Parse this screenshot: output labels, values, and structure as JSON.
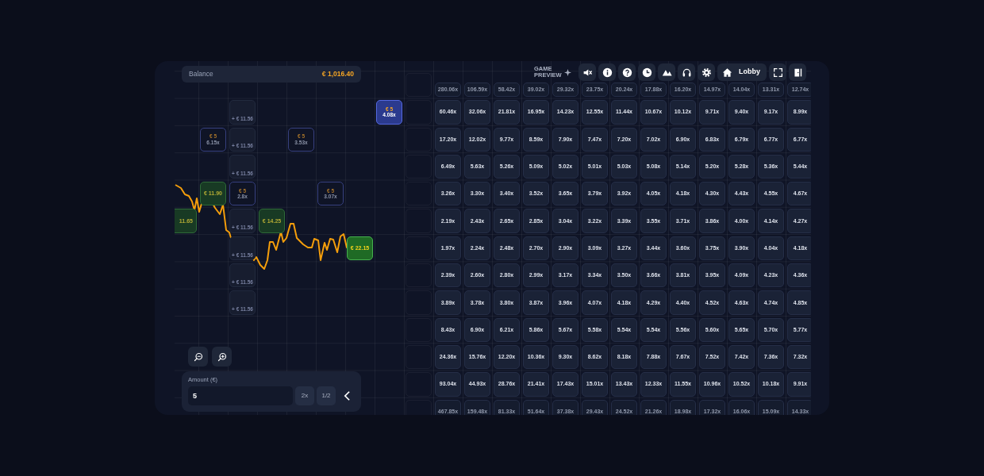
{
  "balance": {
    "label": "Balance",
    "value": "€ 1,016.40"
  },
  "logo": {
    "text": "GAME PREVIEW"
  },
  "toolbar": [
    {
      "kind": "mute"
    },
    {
      "kind": "info"
    },
    {
      "kind": "help"
    },
    {
      "kind": "history"
    },
    {
      "kind": "mountains"
    },
    {
      "kind": "support"
    },
    {
      "kind": "settings"
    },
    {
      "kind": "lobby",
      "label": "Lobby"
    },
    {
      "kind": "fullscreen"
    },
    {
      "kind": "exit"
    }
  ],
  "board": {
    "rows": [
      {
        "faded": true,
        "left": [
          {
            "kind": "blank"
          },
          {
            "kind": "blank"
          },
          {
            "kind": "blank"
          },
          {
            "kind": "blank"
          },
          {
            "kind": "blank"
          },
          {
            "kind": "blank"
          },
          {
            "kind": "blank"
          },
          {
            "kind": "blank"
          },
          {
            "kind": "slot"
          }
        ],
        "multipliers": [
          "280.06x",
          "106.59x",
          "58.42x",
          "39.02x",
          "29.32x",
          "23.75x",
          "20.24x",
          "17.88x",
          "16.20x",
          "14.97x",
          "14.04x",
          "13.31x",
          "12.74x"
        ]
      },
      {
        "faded": false,
        "left": [
          {
            "kind": "blank"
          },
          {
            "kind": "blank"
          },
          {
            "kind": "ghost",
            "payout": "+ € 11.56"
          },
          {
            "kind": "blank"
          },
          {
            "kind": "blank"
          },
          {
            "kind": "blank"
          },
          {
            "kind": "blank"
          },
          {
            "kind": "bet",
            "amount": "€ 5",
            "multiplier": "4.08x",
            "highlighted": true
          },
          {
            "kind": "slot"
          }
        ],
        "multipliers": [
          "60.46x",
          "32.06x",
          "21.81x",
          "16.95x",
          "14.23x",
          "12.55x",
          "11.44x",
          "10.67x",
          "10.12x",
          "9.71x",
          "9.40x",
          "9.17x",
          "8.99x"
        ]
      },
      {
        "faded": false,
        "left": [
          {
            "kind": "blank"
          },
          {
            "kind": "bet",
            "amount": "€ 5",
            "multiplier": "6.15x",
            "highlighted": false
          },
          {
            "kind": "ghost",
            "payout": "+ € 11.56"
          },
          {
            "kind": "blank"
          },
          {
            "kind": "bet",
            "amount": "€ 5",
            "multiplier": "3.53x",
            "highlighted": false
          },
          {
            "kind": "blank"
          },
          {
            "kind": "blank"
          },
          {
            "kind": "blank"
          },
          {
            "kind": "slot"
          }
        ],
        "multipliers": [
          "17.20x",
          "12.02x",
          "9.77x",
          "8.59x",
          "7.90x",
          "7.47x",
          "7.20x",
          "7.02x",
          "6.90x",
          "6.83x",
          "6.79x",
          "6.77x",
          "6.77x"
        ]
      },
      {
        "faded": false,
        "left": [
          {
            "kind": "blank"
          },
          {
            "kind": "blank"
          },
          {
            "kind": "ghost",
            "payout": "+ € 11.56"
          },
          {
            "kind": "blank"
          },
          {
            "kind": "blank"
          },
          {
            "kind": "blank"
          },
          {
            "kind": "blank"
          },
          {
            "kind": "blank"
          },
          {
            "kind": "slot"
          }
        ],
        "multipliers": [
          "6.49x",
          "5.63x",
          "5.26x",
          "5.09x",
          "5.02x",
          "5.01x",
          "5.03x",
          "5.08x",
          "5.14x",
          "5.20x",
          "5.28x",
          "5.36x",
          "5.44x"
        ]
      },
      {
        "faded": false,
        "left": [
          {
            "kind": "blank"
          },
          {
            "kind": "win",
            "amount": "€ 11.90",
            "highlighted": false
          },
          {
            "kind": "bet",
            "amount": "€ 5",
            "multiplier": "2.8x",
            "highlighted": false
          },
          {
            "kind": "blank"
          },
          {
            "kind": "blank"
          },
          {
            "kind": "bet",
            "amount": "€ 5",
            "multiplier": "3.07x",
            "highlighted": false
          },
          {
            "kind": "blank"
          },
          {
            "kind": "blank"
          },
          {
            "kind": "slot"
          }
        ],
        "multipliers": [
          "3.26x",
          "3.30x",
          "3.40x",
          "3.52x",
          "3.65x",
          "3.79x",
          "3.92x",
          "4.05x",
          "4.18x",
          "4.30x",
          "4.43x",
          "4.55x",
          "4.67x"
        ]
      },
      {
        "faded": false,
        "left": [
          {
            "kind": "win",
            "amount": "11.65",
            "highlighted": false
          },
          {
            "kind": "blank"
          },
          {
            "kind": "ghost",
            "payout": "+ € 11.56"
          },
          {
            "kind": "win",
            "amount": "€ 14.25",
            "highlighted": false
          },
          {
            "kind": "blank"
          },
          {
            "kind": "blank"
          },
          {
            "kind": "blank"
          },
          {
            "kind": "blank"
          },
          {
            "kind": "slot"
          }
        ],
        "multipliers": [
          "2.19x",
          "2.43x",
          "2.65x",
          "2.85x",
          "3.04x",
          "3.22x",
          "3.39x",
          "3.55x",
          "3.71x",
          "3.86x",
          "4.00x",
          "4.14x",
          "4.27x"
        ]
      },
      {
        "faded": false,
        "left": [
          {
            "kind": "blank"
          },
          {
            "kind": "blank"
          },
          {
            "kind": "ghost",
            "payout": "+ € 11.56"
          },
          {
            "kind": "blank"
          },
          {
            "kind": "blank"
          },
          {
            "kind": "blank"
          },
          {
            "kind": "win",
            "amount": "€ 22.15",
            "highlighted": true
          },
          {
            "kind": "blank"
          },
          {
            "kind": "slot"
          }
        ],
        "multipliers": [
          "1.97x",
          "2.24x",
          "2.48x",
          "2.70x",
          "2.90x",
          "3.09x",
          "3.27x",
          "3.44x",
          "3.60x",
          "3.75x",
          "3.90x",
          "4.04x",
          "4.18x"
        ]
      },
      {
        "faded": false,
        "left": [
          {
            "kind": "blank"
          },
          {
            "kind": "blank"
          },
          {
            "kind": "ghost",
            "payout": "+ € 11.56"
          },
          {
            "kind": "blank"
          },
          {
            "kind": "blank"
          },
          {
            "kind": "blank"
          },
          {
            "kind": "blank"
          },
          {
            "kind": "blank"
          },
          {
            "kind": "slot"
          }
        ],
        "multipliers": [
          "2.39x",
          "2.60x",
          "2.80x",
          "2.99x",
          "3.17x",
          "3.34x",
          "3.50x",
          "3.66x",
          "3.81x",
          "3.95x",
          "4.09x",
          "4.23x",
          "4.36x"
        ]
      },
      {
        "faded": false,
        "left": [
          {
            "kind": "blank"
          },
          {
            "kind": "blank"
          },
          {
            "kind": "ghost",
            "payout": "+ € 11.56"
          },
          {
            "kind": "blank"
          },
          {
            "kind": "blank"
          },
          {
            "kind": "blank"
          },
          {
            "kind": "blank"
          },
          {
            "kind": "blank"
          },
          {
            "kind": "slot"
          }
        ],
        "multipliers": [
          "3.89x",
          "3.78x",
          "3.80x",
          "3.87x",
          "3.96x",
          "4.07x",
          "4.18x",
          "4.29x",
          "4.40x",
          "4.52x",
          "4.63x",
          "4.74x",
          "4.85x"
        ]
      },
      {
        "faded": false,
        "left": [
          {
            "kind": "blank"
          },
          {
            "kind": "blank"
          },
          {
            "kind": "blank"
          },
          {
            "kind": "blank"
          },
          {
            "kind": "blank"
          },
          {
            "kind": "blank"
          },
          {
            "kind": "blank"
          },
          {
            "kind": "blank"
          },
          {
            "kind": "slot"
          }
        ],
        "multipliers": [
          "8.43x",
          "6.90x",
          "6.21x",
          "5.86x",
          "5.67x",
          "5.58x",
          "5.54x",
          "5.54x",
          "5.56x",
          "5.60x",
          "5.65x",
          "5.70x",
          "5.77x"
        ]
      },
      {
        "faded": false,
        "left": [
          {
            "kind": "blank"
          },
          {
            "kind": "blank"
          },
          {
            "kind": "blank"
          },
          {
            "kind": "blank"
          },
          {
            "kind": "blank"
          },
          {
            "kind": "blank"
          },
          {
            "kind": "blank"
          },
          {
            "kind": "blank"
          },
          {
            "kind": "slot"
          }
        ],
        "multipliers": [
          "24.36x",
          "15.76x",
          "12.20x",
          "10.36x",
          "9.30x",
          "8.62x",
          "8.18x",
          "7.88x",
          "7.67x",
          "7.52x",
          "7.42x",
          "7.36x",
          "7.32x"
        ]
      },
      {
        "faded": false,
        "left": [
          {
            "kind": "blank"
          },
          {
            "kind": "blank"
          },
          {
            "kind": "blank"
          },
          {
            "kind": "blank"
          },
          {
            "kind": "blank"
          },
          {
            "kind": "blank"
          },
          {
            "kind": "blank"
          },
          {
            "kind": "blank"
          },
          {
            "kind": "slot"
          }
        ],
        "multipliers": [
          "93.04x",
          "44.93x",
          "28.76x",
          "21.41x",
          "17.43x",
          "15.01x",
          "13.43x",
          "12.33x",
          "11.55x",
          "10.96x",
          "10.52x",
          "10.18x",
          "9.91x"
        ]
      },
      {
        "faded": true,
        "left": [
          {
            "kind": "blank"
          },
          {
            "kind": "blank"
          },
          {
            "kind": "blank"
          },
          {
            "kind": "blank"
          },
          {
            "kind": "blank"
          },
          {
            "kind": "blank"
          },
          {
            "kind": "blank"
          },
          {
            "kind": "blank"
          },
          {
            "kind": "slot"
          }
        ],
        "multipliers": [
          "467.85x",
          "159.48x",
          "81.33x",
          "51.64x",
          "37.38x",
          "29.43x",
          "24.52x",
          "21.26x",
          "18.98x",
          "17.32x",
          "16.06x",
          "15.09x",
          "14.33x"
        ]
      }
    ]
  },
  "zoom_buttons": [
    {
      "kind": "zoom-out"
    },
    {
      "kind": "zoom-in"
    }
  ],
  "amount": {
    "label": "Amount (€)",
    "value": "5",
    "buttons": [
      "2x",
      "1/2"
    ]
  }
}
